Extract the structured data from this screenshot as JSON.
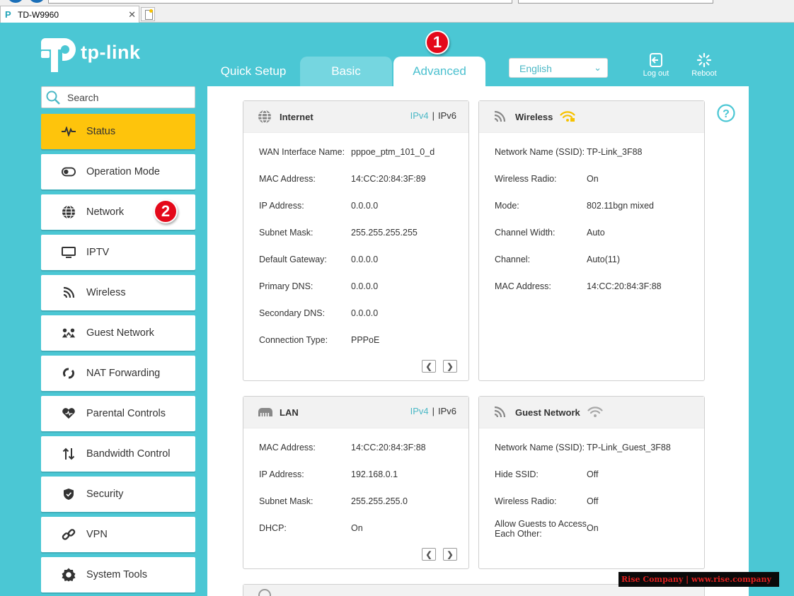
{
  "browser": {
    "tab_title": "TD-W9960",
    "tab_close": "✕"
  },
  "brand": {
    "logo_text": "tp-link"
  },
  "topnav": {
    "quick_setup": "Quick Setup",
    "basic": "Basic",
    "advanced": "Advanced",
    "language": "English",
    "logout": "Log out",
    "reboot": "Reboot"
  },
  "badges": {
    "one": "1",
    "two": "2"
  },
  "search": {
    "placeholder": "Search"
  },
  "sidebar": {
    "items": [
      {
        "label": "Status",
        "icon": "pulse-icon"
      },
      {
        "label": "Operation Mode",
        "icon": "toggle-icon"
      },
      {
        "label": "Network",
        "icon": "globe-icon"
      },
      {
        "label": "IPTV",
        "icon": "monitor-icon"
      },
      {
        "label": "Wireless",
        "icon": "wifi-icon"
      },
      {
        "label": "Guest Network",
        "icon": "guest-icon"
      },
      {
        "label": "NAT Forwarding",
        "icon": "nat-icon"
      },
      {
        "label": "Parental Controls",
        "icon": "heart-icon"
      },
      {
        "label": "Bandwidth Control",
        "icon": "arrows-icon"
      },
      {
        "label": "Security",
        "icon": "shield-icon"
      },
      {
        "label": "VPN",
        "icon": "link-icon"
      },
      {
        "label": "System Tools",
        "icon": "gear-icon"
      }
    ]
  },
  "internet": {
    "title": "Internet",
    "ipv4": "IPv4",
    "sep": "|",
    "ipv6": "IPv6",
    "rows": [
      {
        "k": "WAN Interface Name:",
        "v": "pppoe_ptm_101_0_d"
      },
      {
        "k": "MAC Address:",
        "v": "14:CC:20:84:3F:89"
      },
      {
        "k": "IP Address:",
        "v": "0.0.0.0"
      },
      {
        "k": "Subnet Mask:",
        "v": "255.255.255.255"
      },
      {
        "k": "Default Gateway:",
        "v": "0.0.0.0"
      },
      {
        "k": "Primary DNS:",
        "v": "0.0.0.0"
      },
      {
        "k": "Secondary DNS:",
        "v": "0.0.0.0"
      },
      {
        "k": "Connection Type:",
        "v": "PPPoE"
      }
    ]
  },
  "wireless": {
    "title": "Wireless",
    "signal_color": "#f6c200",
    "rows": [
      {
        "k": "Network Name (SSID):",
        "v": "TP-Link_3F88"
      },
      {
        "k": "Wireless Radio:",
        "v": "On"
      },
      {
        "k": "Mode:",
        "v": "802.11bgn mixed"
      },
      {
        "k": "Channel Width:",
        "v": "Auto"
      },
      {
        "k": "Channel:",
        "v": "Auto(11)"
      },
      {
        "k": "MAC Address:",
        "v": "14:CC:20:84:3F:88"
      }
    ]
  },
  "lan": {
    "title": "LAN",
    "ipv4": "IPv4",
    "sep": "|",
    "ipv6": "IPv6",
    "rows": [
      {
        "k": "MAC Address:",
        "v": "14:CC:20:84:3F:88"
      },
      {
        "k": "IP Address:",
        "v": "192.168.0.1"
      },
      {
        "k": "Subnet Mask:",
        "v": "255.255.255.0"
      },
      {
        "k": "DHCP:",
        "v": "On"
      }
    ]
  },
  "guest": {
    "title": "Guest Network",
    "rows": [
      {
        "k": "Network Name (SSID):",
        "v": "TP-Link_Guest_3F88"
      },
      {
        "k": "Hide SSID:",
        "v": "Off"
      },
      {
        "k": "Wireless Radio:",
        "v": "Off"
      },
      {
        "k": "Allow Guests to Access Each Other:",
        "v": "On"
      }
    ]
  },
  "pager": {
    "prev": "❮",
    "next": "❯"
  },
  "watermark": {
    "text": "Rise Company | www.rise.company"
  },
  "colors": {
    "accent": "#4bc7d4",
    "active": "#fec40c",
    "badge": "#e4091a"
  }
}
